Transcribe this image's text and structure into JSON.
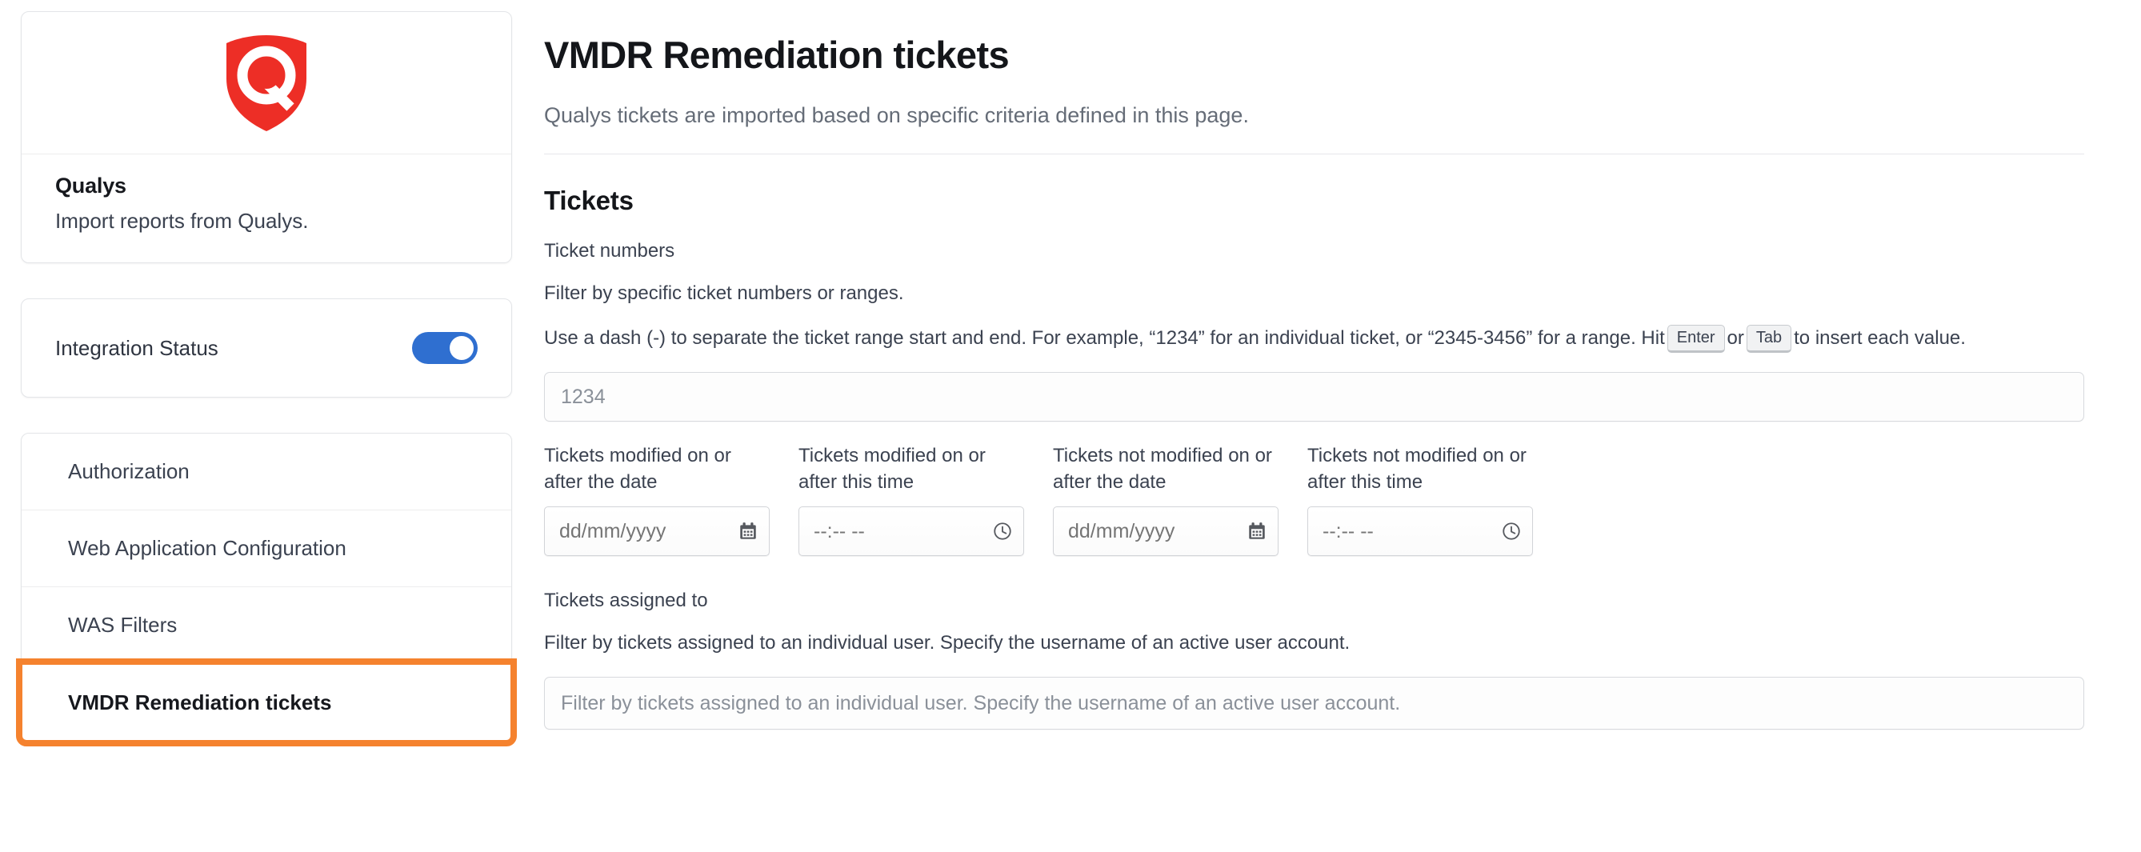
{
  "brand": {
    "logo_icon": "qualys-shield-logo",
    "logo_color": "#ED2E26",
    "title": "Qualys",
    "subtitle": "Import reports from Qualys."
  },
  "status": {
    "label": "Integration Status",
    "toggle_state": "on",
    "toggle_color": "#2F6FD0"
  },
  "nav": {
    "items": [
      {
        "label": "Authorization",
        "selected": false
      },
      {
        "label": "Web Application Configuration",
        "selected": false
      },
      {
        "label": "WAS Filters",
        "selected": false
      },
      {
        "label": "VMDR Remediation tickets",
        "selected": true
      }
    ],
    "selected_outline_color": "#F5822E"
  },
  "main": {
    "title": "VMDR Remediation tickets",
    "description": "Qualys tickets are imported based on specific criteria defined in this page.",
    "section_title": "Tickets",
    "ticket_numbers": {
      "label": "Ticket numbers",
      "help_1": "Filter by specific ticket numbers or ranges.",
      "help_2_part1": "Use a dash (-) to separate the ticket range start and end. For example, “1234” for an individual ticket, or “2345-3456” for a range. Hit",
      "key_enter": "Enter",
      "help_2_mid": "or",
      "key_tab": "Tab",
      "help_2_part2": "to insert each value.",
      "placeholder": "1234",
      "value": ""
    },
    "date_fields": [
      {
        "label": "Tickets modified on or after the date",
        "placeholder": "dd/mm/yyyy",
        "value": "",
        "icon": "calendar-icon",
        "type": "date"
      },
      {
        "label": "Tickets modified on or after this time",
        "placeholder": "--:-- --",
        "value": "",
        "icon": "clock-icon",
        "type": "time"
      },
      {
        "label": "Tickets not modified on or after the date",
        "placeholder": "dd/mm/yyyy",
        "value": "",
        "icon": "calendar-icon",
        "type": "date"
      },
      {
        "label": "Tickets not modified on or after this time",
        "placeholder": "--:-- --",
        "value": "",
        "icon": "clock-icon",
        "type": "time"
      }
    ],
    "assigned_to": {
      "label": "Tickets assigned to",
      "help": "Filter by tickets assigned to an individual user. Specify the username of an active user account.",
      "placeholder": "Filter by tickets assigned to an individual user. Specify the username of an active user account.",
      "value": ""
    }
  }
}
